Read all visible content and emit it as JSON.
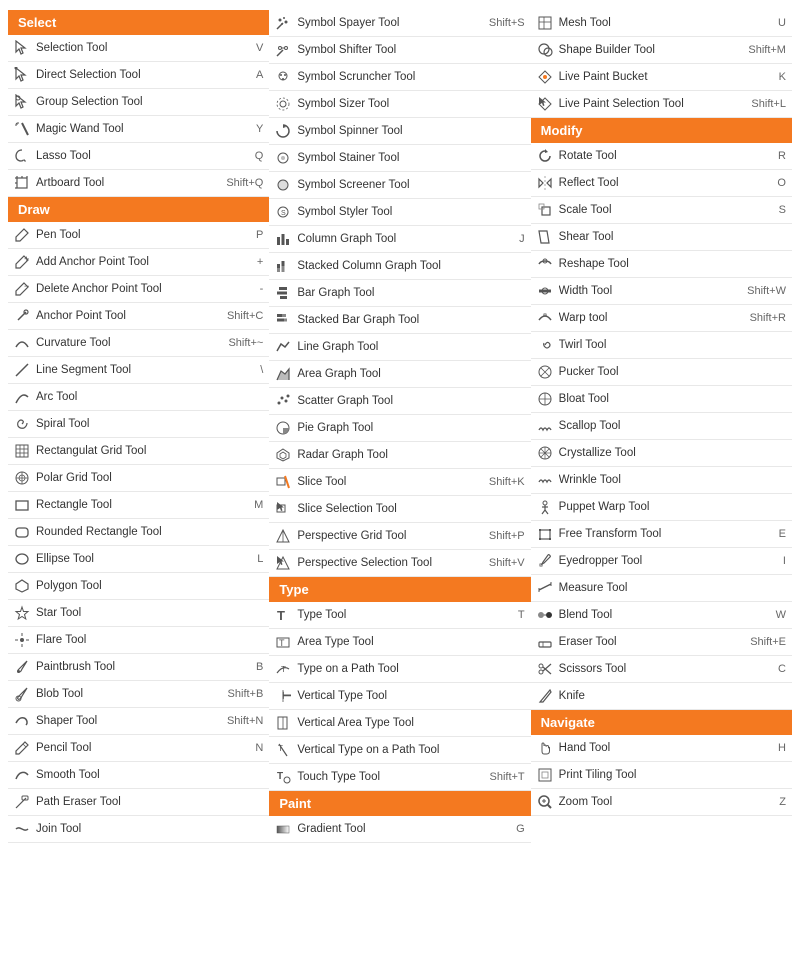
{
  "columns": [
    {
      "sections": [
        {
          "header": "Select",
          "headerColor": "#f47920",
          "tools": [
            {
              "name": "Selection Tool",
              "shortcut": "V",
              "icon": "selection"
            },
            {
              "name": "Direct Selection Tool",
              "shortcut": "A",
              "icon": "direct-selection"
            },
            {
              "name": "Group Selection Tool",
              "shortcut": "",
              "icon": "group-selection"
            },
            {
              "name": "Magic Wand Tool",
              "shortcut": "Y",
              "icon": "magic-wand"
            },
            {
              "name": "Lasso Tool",
              "shortcut": "Q",
              "icon": "lasso"
            },
            {
              "name": "Artboard Tool",
              "shortcut": "Shift+Q",
              "icon": "artboard"
            }
          ]
        },
        {
          "header": "Draw",
          "headerColor": "#f47920",
          "tools": [
            {
              "name": "Pen Tool",
              "shortcut": "P",
              "icon": "pen"
            },
            {
              "name": "Add Anchor Point Tool",
              "shortcut": "+",
              "icon": "add-anchor"
            },
            {
              "name": "Delete Anchor Point Tool",
              "shortcut": "-",
              "icon": "delete-anchor"
            },
            {
              "name": "Anchor Point Tool",
              "shortcut": "Shift+C",
              "icon": "anchor-point"
            },
            {
              "name": "Curvature Tool",
              "shortcut": "Shift+~",
              "icon": "curvature"
            },
            {
              "name": "Line Segment Tool",
              "shortcut": "\\",
              "icon": "line-segment"
            },
            {
              "name": "Arc Tool",
              "shortcut": "",
              "icon": "arc"
            },
            {
              "name": "Spiral Tool",
              "shortcut": "",
              "icon": "spiral"
            },
            {
              "name": "Rectangulat Grid Tool",
              "shortcut": "",
              "icon": "rect-grid"
            },
            {
              "name": "Polar Grid Tool",
              "shortcut": "",
              "icon": "polar-grid"
            },
            {
              "name": "Rectangle Tool",
              "shortcut": "M",
              "icon": "rectangle"
            },
            {
              "name": "Rounded Rectangle Tool",
              "shortcut": "",
              "icon": "rounded-rect"
            },
            {
              "name": "Ellipse Tool",
              "shortcut": "L",
              "icon": "ellipse"
            },
            {
              "name": "Polygon Tool",
              "shortcut": "",
              "icon": "polygon"
            },
            {
              "name": "Star Tool",
              "shortcut": "",
              "icon": "star"
            },
            {
              "name": "Flare Tool",
              "shortcut": "",
              "icon": "flare"
            },
            {
              "name": "Paintbrush Tool",
              "shortcut": "B",
              "icon": "paintbrush"
            },
            {
              "name": "Blob Tool",
              "shortcut": "Shift+B",
              "icon": "blob"
            },
            {
              "name": "Shaper Tool",
              "shortcut": "Shift+N",
              "icon": "shaper"
            },
            {
              "name": "Pencil Tool",
              "shortcut": "N",
              "icon": "pencil"
            },
            {
              "name": "Smooth Tool",
              "shortcut": "",
              "icon": "smooth"
            },
            {
              "name": "Path Eraser Tool",
              "shortcut": "",
              "icon": "path-eraser"
            },
            {
              "name": "Join Tool",
              "shortcut": "",
              "icon": "join"
            }
          ]
        }
      ]
    },
    {
      "sections": [
        {
          "header": null,
          "tools": [
            {
              "name": "Symbol Spayer Tool",
              "shortcut": "Shift+S",
              "icon": "symbol-sprayer"
            },
            {
              "name": "Symbol Shifter Tool",
              "shortcut": "",
              "icon": "symbol-shifter"
            },
            {
              "name": "Symbol Scruncher Tool",
              "shortcut": "",
              "icon": "symbol-scruncher"
            },
            {
              "name": "Symbol Sizer Tool",
              "shortcut": "",
              "icon": "symbol-sizer"
            },
            {
              "name": "Symbol Spinner Tool",
              "shortcut": "",
              "icon": "symbol-spinner"
            },
            {
              "name": "Symbol Stainer Tool",
              "shortcut": "",
              "icon": "symbol-stainer"
            },
            {
              "name": "Symbol Screener Tool",
              "shortcut": "",
              "icon": "symbol-screener"
            },
            {
              "name": "Symbol Styler Tool",
              "shortcut": "",
              "icon": "symbol-styler"
            },
            {
              "name": "Column Graph Tool",
              "shortcut": "J",
              "icon": "column-graph"
            },
            {
              "name": "Stacked Column Graph Tool",
              "shortcut": "",
              "icon": "stacked-column-graph"
            },
            {
              "name": "Bar Graph Tool",
              "shortcut": "",
              "icon": "bar-graph"
            },
            {
              "name": "Stacked Bar Graph Tool",
              "shortcut": "",
              "icon": "stacked-bar-graph"
            },
            {
              "name": "Line Graph Tool",
              "shortcut": "",
              "icon": "line-graph"
            },
            {
              "name": "Area Graph Tool",
              "shortcut": "",
              "icon": "area-graph"
            },
            {
              "name": "Scatter Graph Tool",
              "shortcut": "",
              "icon": "scatter-graph"
            },
            {
              "name": "Pie Graph Tool",
              "shortcut": "",
              "icon": "pie-graph"
            },
            {
              "name": "Radar Graph Tool",
              "shortcut": "",
              "icon": "radar-graph"
            },
            {
              "name": "Slice Tool",
              "shortcut": "Shift+K",
              "icon": "slice"
            },
            {
              "name": "Slice Selection Tool",
              "shortcut": "",
              "icon": "slice-selection"
            },
            {
              "name": "Perspective Grid Tool",
              "shortcut": "Shift+P",
              "icon": "perspective-grid"
            },
            {
              "name": "Perspective Selection Tool",
              "shortcut": "Shift+V",
              "icon": "perspective-selection"
            }
          ]
        },
        {
          "header": "Type",
          "headerColor": "#f47920",
          "tools": [
            {
              "name": "Type Tool",
              "shortcut": "T",
              "icon": "type"
            },
            {
              "name": "Area Type Tool",
              "shortcut": "",
              "icon": "area-type"
            },
            {
              "name": "Type on a Path Tool",
              "shortcut": "",
              "icon": "type-path"
            },
            {
              "name": "Vertical Type Tool",
              "shortcut": "",
              "icon": "vertical-type"
            },
            {
              "name": "Vertical Area Type Tool",
              "shortcut": "",
              "icon": "vertical-area-type"
            },
            {
              "name": "Vertical Type on a Path Tool",
              "shortcut": "",
              "icon": "vertical-type-path"
            },
            {
              "name": "Touch Type Tool",
              "shortcut": "Shift+T",
              "icon": "touch-type"
            }
          ]
        },
        {
          "header": "Paint",
          "headerColor": "#f47920",
          "tools": [
            {
              "name": "Gradient Tool",
              "shortcut": "G",
              "icon": "gradient"
            }
          ]
        }
      ]
    },
    {
      "sections": [
        {
          "header": null,
          "tools": [
            {
              "name": "Mesh Tool",
              "shortcut": "U",
              "icon": "mesh"
            },
            {
              "name": "Shape Builder Tool",
              "shortcut": "Shift+M",
              "icon": "shape-builder"
            },
            {
              "name": "Live Paint Bucket",
              "shortcut": "K",
              "icon": "live-paint"
            },
            {
              "name": "Live Paint Selection Tool",
              "shortcut": "Shift+L",
              "icon": "live-paint-selection"
            }
          ]
        },
        {
          "header": "Modify",
          "headerColor": "#f47920",
          "tools": [
            {
              "name": "Rotate Tool",
              "shortcut": "R",
              "icon": "rotate"
            },
            {
              "name": "Reflect Tool",
              "shortcut": "O",
              "icon": "reflect"
            },
            {
              "name": "Scale Tool",
              "shortcut": "S",
              "icon": "scale"
            },
            {
              "name": "Shear Tool",
              "shortcut": "",
              "icon": "shear"
            },
            {
              "name": "Reshape Tool",
              "shortcut": "",
              "icon": "reshape"
            },
            {
              "name": "Width Tool",
              "shortcut": "Shift+W",
              "icon": "width"
            },
            {
              "name": "Warp tool",
              "shortcut": "Shift+R",
              "icon": "warp"
            },
            {
              "name": "Twirl Tool",
              "shortcut": "",
              "icon": "twirl"
            },
            {
              "name": "Pucker Tool",
              "shortcut": "",
              "icon": "pucker"
            },
            {
              "name": "Bloat Tool",
              "shortcut": "",
              "icon": "bloat"
            },
            {
              "name": "Scallop Tool",
              "shortcut": "",
              "icon": "scallop"
            },
            {
              "name": "Crystallize Tool",
              "shortcut": "",
              "icon": "crystallize"
            },
            {
              "name": "Wrinkle Tool",
              "shortcut": "",
              "icon": "wrinkle"
            },
            {
              "name": "Puppet Warp Tool",
              "shortcut": "",
              "icon": "puppet-warp"
            },
            {
              "name": "Free Transform Tool",
              "shortcut": "E",
              "icon": "free-transform"
            },
            {
              "name": "Eyedropper Tool",
              "shortcut": "I",
              "icon": "eyedropper"
            },
            {
              "name": "Measure Tool",
              "shortcut": "",
              "icon": "measure"
            },
            {
              "name": "Blend Tool",
              "shortcut": "W",
              "icon": "blend"
            },
            {
              "name": "Eraser Tool",
              "shortcut": "Shift+E",
              "icon": "eraser"
            },
            {
              "name": "Scissors Tool",
              "shortcut": "C",
              "icon": "scissors"
            },
            {
              "name": "Knife",
              "shortcut": "",
              "icon": "knife"
            }
          ]
        },
        {
          "header": "Navigate",
          "headerColor": "#f47920",
          "tools": [
            {
              "name": "Hand Tool",
              "shortcut": "H",
              "icon": "hand"
            },
            {
              "name": "Print Tiling Tool",
              "shortcut": "",
              "icon": "print-tiling"
            },
            {
              "name": "Zoom Tool",
              "shortcut": "Z",
              "icon": "zoom"
            }
          ]
        }
      ]
    }
  ]
}
